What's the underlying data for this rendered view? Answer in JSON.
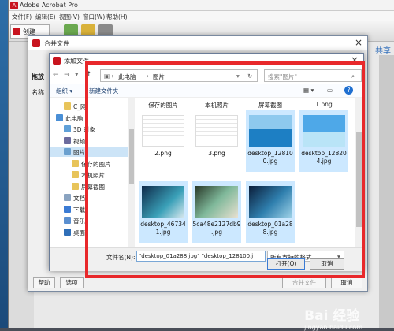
{
  "acrobat": {
    "title": "Adobe Acrobat Pro",
    "menu": [
      "文件(F)",
      "编辑(E)",
      "视图(V)",
      "窗口(W)",
      "帮助(H)"
    ],
    "create_label": "创建",
    "share_label": "共享"
  },
  "merge": {
    "title": "合并文件",
    "left_tab": "拖放",
    "name_col": "名称",
    "help_label": "帮助",
    "options_label": "选项",
    "merge_label": "合并文件",
    "cancel_label": "取消"
  },
  "add": {
    "title": "添加文件",
    "path": [
      "此电脑",
      "图片"
    ],
    "search_placeholder": "搜索\"图片\"",
    "organize": "组织 ▾",
    "new_folder": "新建文件夹",
    "nav": [
      {
        "label": "C_网",
        "icon": "folder-icon",
        "indent": 1
      },
      {
        "label": "此电脑",
        "icon": "computer-icon",
        "indent": 0
      },
      {
        "label": "3D 对象",
        "icon": "cube-icon",
        "indent": 1
      },
      {
        "label": "视频",
        "icon": "video-icon",
        "indent": 1
      },
      {
        "label": "图片",
        "icon": "pictures-icon",
        "indent": 1,
        "selected": true
      },
      {
        "label": "保存的图片",
        "icon": "folder-icon",
        "indent": 2
      },
      {
        "label": "本机照片",
        "icon": "folder-icon",
        "indent": 2
      },
      {
        "label": "屏幕截图",
        "icon": "folder-icon",
        "indent": 2
      },
      {
        "label": "文档",
        "icon": "document-icon",
        "indent": 1
      },
      {
        "label": "下载",
        "icon": "download-icon",
        "indent": 1
      },
      {
        "label": "音乐",
        "icon": "music-icon",
        "indent": 1
      },
      {
        "label": "桌面",
        "icon": "desktop-icon",
        "indent": 1
      }
    ],
    "top_labels": [
      "保存的图片",
      "本机照片",
      "屏幕截图",
      "1.png"
    ],
    "files": [
      {
        "name": "2.png",
        "selected": false,
        "thumb": "doc"
      },
      {
        "name": "3.png",
        "selected": false,
        "thumb": "doc"
      },
      {
        "name": "desktop_12810 0.jpg",
        "selected": true,
        "thumb": "sea"
      },
      {
        "name": "desktop_12820 4.jpg",
        "selected": true,
        "thumb": "sky"
      },
      {
        "name": "desktop_46734 1.jpg",
        "selected": true,
        "thumb": "anime"
      },
      {
        "name": "5ca48e2127db9 .jpg",
        "selected": true,
        "thumb": "anime2"
      },
      {
        "name": "desktop_01a28 8.jpg",
        "selected": true,
        "thumb": "anime3"
      }
    ],
    "filename_label": "文件名(N):",
    "filename_value": "\"desktop_01a288.jpg\" \"desktop_128100.j",
    "filetype": "所有支持的格式",
    "open_label": "打开(O)",
    "cancel_label": "取消"
  },
  "watermark": {
    "brand": "Bai 经验",
    "url": "jingyan.baidu.com"
  },
  "colors": {
    "highlight": "#e8282b",
    "selection": "#cce8ff"
  }
}
